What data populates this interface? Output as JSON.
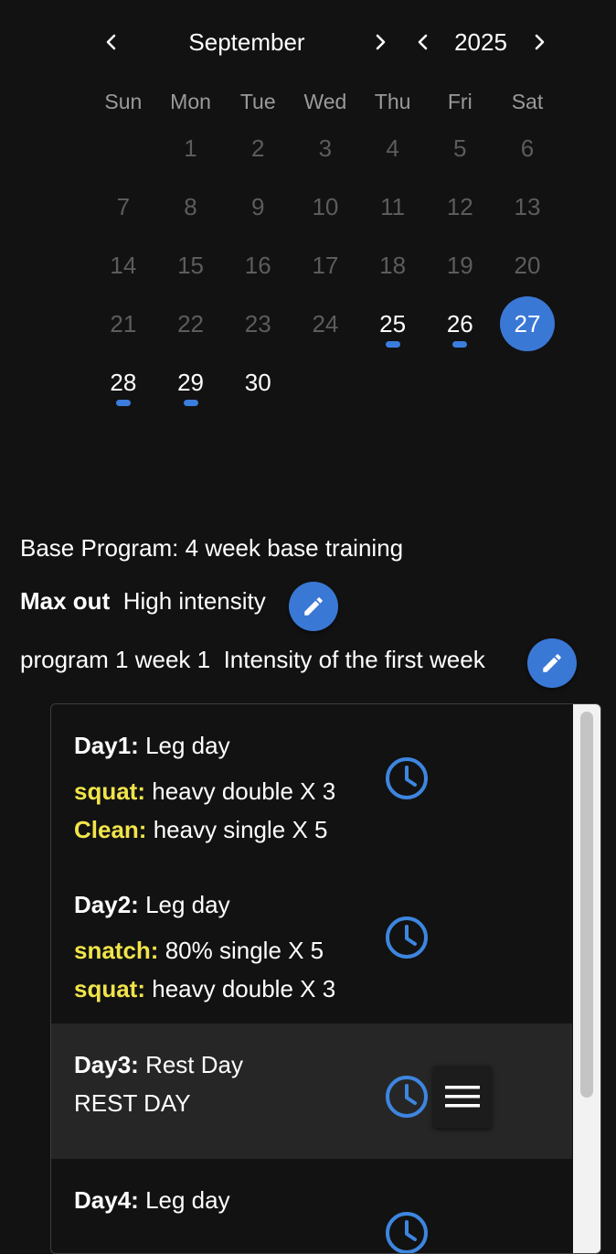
{
  "calendar": {
    "month": "September",
    "year": "2025",
    "weekdays": [
      "Sun",
      "Mon",
      "Tue",
      "Wed",
      "Thu",
      "Fri",
      "Sat"
    ],
    "weeks": [
      [
        null,
        {
          "d": "1"
        },
        {
          "d": "2"
        },
        {
          "d": "3"
        },
        {
          "d": "4"
        },
        {
          "d": "5"
        },
        {
          "d": "6"
        }
      ],
      [
        {
          "d": "7"
        },
        {
          "d": "8"
        },
        {
          "d": "9"
        },
        {
          "d": "10"
        },
        {
          "d": "11"
        },
        {
          "d": "12"
        },
        {
          "d": "13"
        }
      ],
      [
        {
          "d": "14"
        },
        {
          "d": "15"
        },
        {
          "d": "16"
        },
        {
          "d": "17"
        },
        {
          "d": "18"
        },
        {
          "d": "19"
        },
        {
          "d": "20"
        }
      ],
      [
        {
          "d": "21"
        },
        {
          "d": "22"
        },
        {
          "d": "23"
        },
        {
          "d": "24"
        },
        {
          "d": "25",
          "active": true,
          "dot": true
        },
        {
          "d": "26",
          "active": true,
          "dot": true
        },
        {
          "d": "27",
          "active": true,
          "selected": true
        }
      ],
      [
        {
          "d": "28",
          "active": true,
          "dot": true
        },
        {
          "d": "29",
          "active": true,
          "dot": true
        },
        {
          "d": "30",
          "active": true
        },
        null,
        null,
        null,
        null
      ]
    ],
    "colors": {
      "selected": "#3a78d6",
      "dot": "#3b7ddd",
      "inactive": "#5c5c5c"
    }
  },
  "program": {
    "base_label": "Base Program: 4 week base training",
    "phase_name": "Max out",
    "phase_desc": "High intensity",
    "week_name": "program 1 week 1",
    "week_desc": "Intensity of the first week"
  },
  "days": [
    {
      "label": "Day1:",
      "title": "Leg day",
      "exercises": [
        {
          "name": "squat:",
          "detail": "heavy double X 3"
        },
        {
          "name": "Clean:",
          "detail": "heavy single X 5"
        }
      ]
    },
    {
      "label": "Day2:",
      "title": "Leg day",
      "exercises": [
        {
          "name": "snatch:",
          "detail": "80% single X 5"
        },
        {
          "name": "squat:",
          "detail": "heavy double X 3"
        }
      ]
    },
    {
      "label": "Day3:",
      "title": "Rest Day",
      "rest_text": "REST DAY"
    },
    {
      "label": "Day4:",
      "title": "Leg day"
    }
  ],
  "icons": {
    "prev": "chevron-left-icon",
    "next": "chevron-right-icon",
    "edit": "pencil-icon",
    "timer": "clock-icon",
    "drag": "menu-icon"
  },
  "accent": "#3a78d6",
  "exercise_color": "#f0e44a"
}
